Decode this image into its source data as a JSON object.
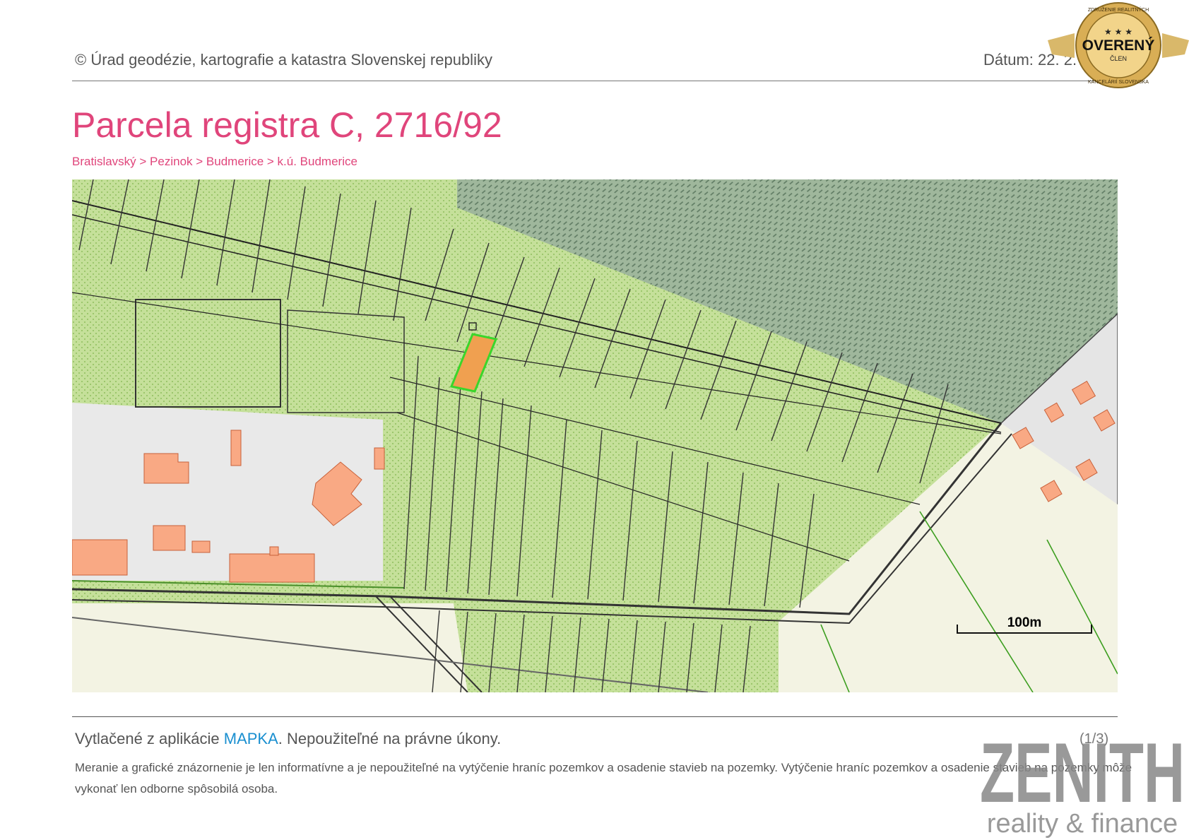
{
  "header": {
    "source": "© Úrad geodézie, kartografie a katastra Slovenskej republiky",
    "date": "Dátum: 22. 2."
  },
  "title": "Parcela registra C, 2716/92",
  "breadcrumb": "Bratislavský > Pezinok > Budmerice > k.ú. Budmerice",
  "map": {
    "scale_label": "100m",
    "colors": {
      "vegetation": "#c5e09a",
      "forest": "#93a890",
      "built_area": "#e8e8e8",
      "buildings": "#f9a984",
      "selected_parcel_fill": "#f0a050",
      "selected_parcel_border": "#3ad62b",
      "field": "#f3f3e3"
    }
  },
  "footer": {
    "printed_prefix": "Vytlačené z aplikácie ",
    "printed_link": "MAPKA",
    "printed_suffix": ". Nepoužiteľné na právne úkony.",
    "page": "(1/3)",
    "note": "Meranie a grafické znázornenie je len informatívne a je nepoužiteľné na vytýčenie hraníc pozemkov a osadenie stavieb na pozemky. Vytýčenie hraníc pozemkov a osadenie stavieb na pozemky môže vykonať len odborne spôsobilá osoba."
  },
  "badge": {
    "text": "OVERENÝ",
    "member": "ČLEN",
    "ring_top": "ZDRUŽENIE REALITNÝCH",
    "ring_bottom": "KANCELÁRIÍ SLOVENSKA"
  },
  "watermark": {
    "name": "ZENITH",
    "tagline": "reality & finance"
  }
}
